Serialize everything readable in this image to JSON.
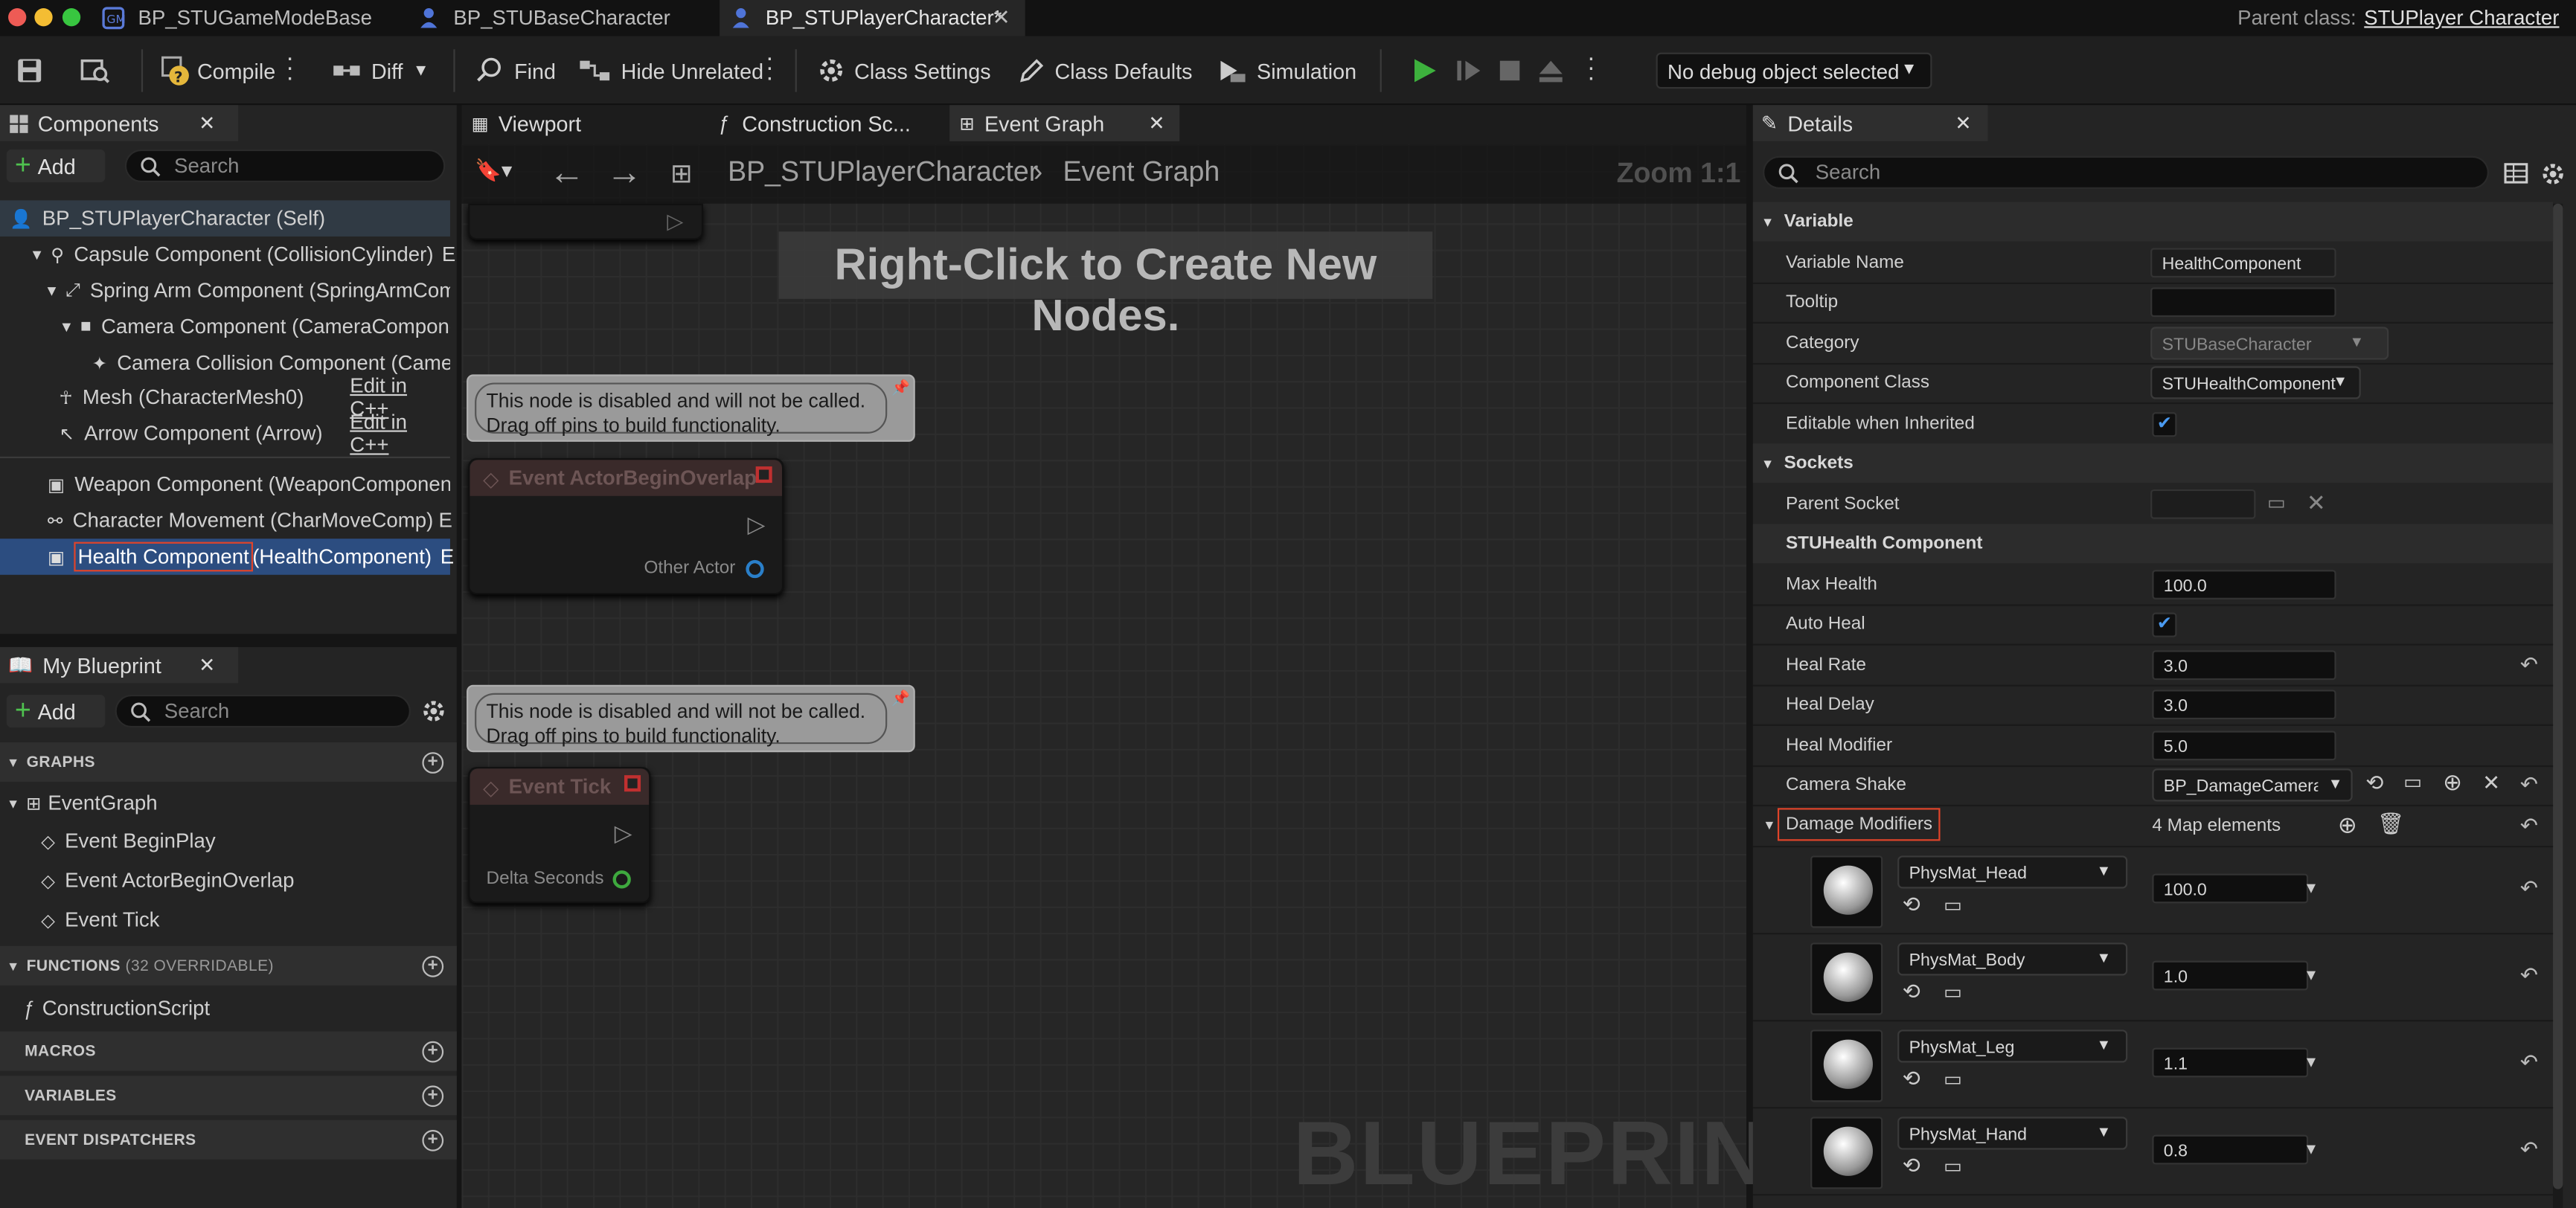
{
  "tabs": [
    {
      "label": "BP_STUGameModeBase"
    },
    {
      "label": "BP_STUBaseCharacter"
    },
    {
      "label": "BP_STUPlayerCharacter*"
    }
  ],
  "parent_class": {
    "label": "Parent class:",
    "value": "STUPlayer Character"
  },
  "toolbar": {
    "compile": "Compile",
    "diff": "Diff",
    "find": "Find",
    "hide_unrelated": "Hide Unrelated",
    "class_settings": "Class Settings",
    "class_defaults": "Class Defaults",
    "simulation": "Simulation",
    "debug": "No debug object selected"
  },
  "components": {
    "title": "Components",
    "add": "Add",
    "search_placeholder": "Search",
    "items": [
      {
        "label": "BP_STUPlayerCharacter (Self)"
      },
      {
        "label": "Capsule Component (CollisionCylinder)",
        "suffix": "E"
      },
      {
        "label": "Spring Arm Component (SpringArmCom"
      },
      {
        "label": "Camera Component (CameraCompone"
      },
      {
        "label": "Camera Collision Component (Came"
      },
      {
        "label": "Mesh (CharacterMesh0)",
        "edit": "Edit in C++"
      },
      {
        "label": "Arrow Component (Arrow)",
        "edit": "Edit in C++"
      },
      {
        "label": "Weapon Component (WeaponComponent)"
      },
      {
        "label": "Character Movement (CharMoveComp)",
        "suffix": "E"
      },
      {
        "label_a": "Health Component",
        "label_b": " (HealthComponent)",
        "suffix": "E"
      }
    ]
  },
  "my_blueprint": {
    "title": "My Blueprint",
    "add": "Add",
    "search_placeholder": "Search",
    "graphs": "GRAPHS",
    "event_graph": "EventGraph",
    "events": [
      "Event BeginPlay",
      "Event ActorBeginOverlap",
      "Event Tick"
    ],
    "functions": "FUNCTIONS",
    "functions_note": "(32 OVERRIDABLE)",
    "construction": "ConstructionScript",
    "macros": "MACROS",
    "variables": "VARIABLES",
    "dispatchers": "EVENT DISPATCHERS"
  },
  "graph_tabs": [
    "Viewport",
    "Construction Sc...",
    "Event Graph"
  ],
  "graph": {
    "breadcrumb_root": "BP_STUPlayerCharacter",
    "breadcrumb_leaf": "Event Graph",
    "zoom": "Zoom 1:1",
    "hint": "Right-Click to Create New Nodes.",
    "comment_line1": "This node is disabled and will not be called.",
    "comment_line2": "Drag off pins to build functionality.",
    "node1_title": "Event ActorBeginOverlap",
    "node1_pin": "Other Actor",
    "node2_title": "Event Tick",
    "node2_pin": "Delta Seconds",
    "watermark": "BLUEPRINT"
  },
  "details": {
    "title": "Details",
    "search_placeholder": "Search",
    "sec_variable": "Variable",
    "variable_name_label": "Variable Name",
    "variable_name": "HealthComponent",
    "tooltip_label": "Tooltip",
    "category_label": "Category",
    "category": "STUBaseCharacter",
    "component_class_label": "Component Class",
    "component_class": "STUHealthComponent",
    "editable_label": "Editable when Inherited",
    "sec_sockets": "Sockets",
    "parent_socket_label": "Parent Socket",
    "sec_health": "STUHealth Component",
    "max_health_label": "Max Health",
    "max_health": "100.0",
    "auto_heal_label": "Auto Heal",
    "heal_rate_label": "Heal Rate",
    "heal_rate": "3.0",
    "heal_delay_label": "Heal Delay",
    "heal_delay": "3.0",
    "heal_modifier_label": "Heal Modifier",
    "heal_modifier": "5.0",
    "camera_shake_label": "Camera Shake",
    "camera_shake": "BP_DamageCameraS",
    "damage_modifiers_label": "Damage Modifiers",
    "map_count": "4 Map elements",
    "modifiers": [
      {
        "key": "PhysMat_Head",
        "value": "100.0"
      },
      {
        "key": "PhysMat_Body",
        "value": "1.0"
      },
      {
        "key": "PhysMat_Leg",
        "value": "1.1"
      },
      {
        "key": "PhysMat_Hand",
        "value": "0.8"
      }
    ]
  }
}
